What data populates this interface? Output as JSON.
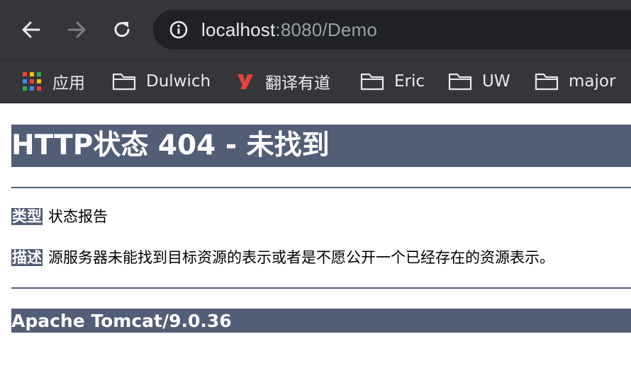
{
  "browser": {
    "url_host": "localhost",
    "url_rest": ":8080/Demo",
    "nav": {
      "back": "back-arrow",
      "forward": "forward-arrow",
      "reload": "reload"
    },
    "bookmarks": [
      {
        "label": "应用",
        "icon": "apps-grid-icon"
      },
      {
        "label": "Dulwich",
        "icon": "folder-icon"
      },
      {
        "label": "翻译有道",
        "icon": "youdao-logo-icon"
      },
      {
        "label": "Eric",
        "icon": "folder-icon"
      },
      {
        "label": "UW",
        "icon": "folder-icon"
      },
      {
        "label": "major",
        "icon": "folder-icon"
      }
    ]
  },
  "page": {
    "title": "HTTP状态 404 - 未找到",
    "type_label": "类型",
    "type_value": "状态报告",
    "description_label": "描述",
    "description_value": "源服务器未能找到目标资源的表示或者是不愿公开一个已经存在的资源表示。",
    "server_footer": "Apache Tomcat/9.0.36",
    "accent_color": "#525d76"
  }
}
